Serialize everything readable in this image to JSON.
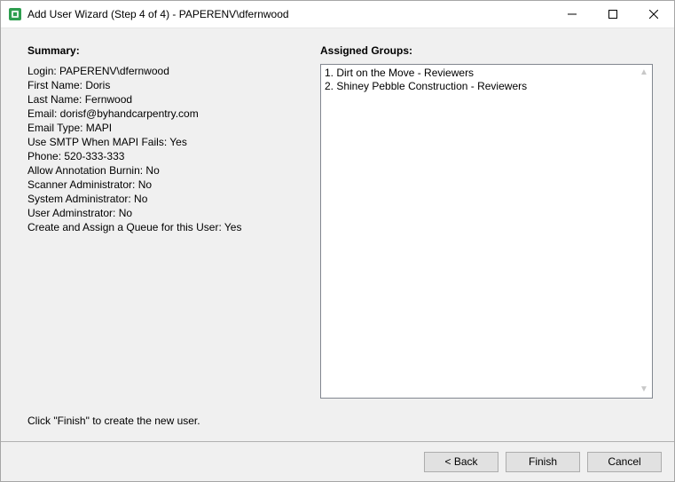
{
  "window": {
    "title": "Add User Wizard (Step 4 of 4) - PAPERENV\\dfernwood"
  },
  "summary": {
    "heading": "Summary:",
    "lines": [
      "Login: PAPERENV\\dfernwood",
      "First Name: Doris",
      "Last Name: Fernwood",
      "Email: dorisf@byhandcarpentry.com",
      "Email Type: MAPI",
      "Use SMTP When MAPI Fails: Yes",
      "Phone: 520-333-333",
      "Allow Annotation Burnin: No",
      "Scanner Administrator: No",
      "System Administrator: No",
      "User Adminstrator: No",
      "Create and Assign a Queue for this User: Yes"
    ]
  },
  "groups": {
    "heading": "Assigned Groups:",
    "items": [
      "1. Dirt on the Move - Reviewers",
      "2. Shiney Pebble Construction - Reviewers"
    ]
  },
  "hint": "Click \"Finish\" to create the new user.",
  "buttons": {
    "back": "< Back",
    "finish": "Finish",
    "cancel": "Cancel"
  }
}
